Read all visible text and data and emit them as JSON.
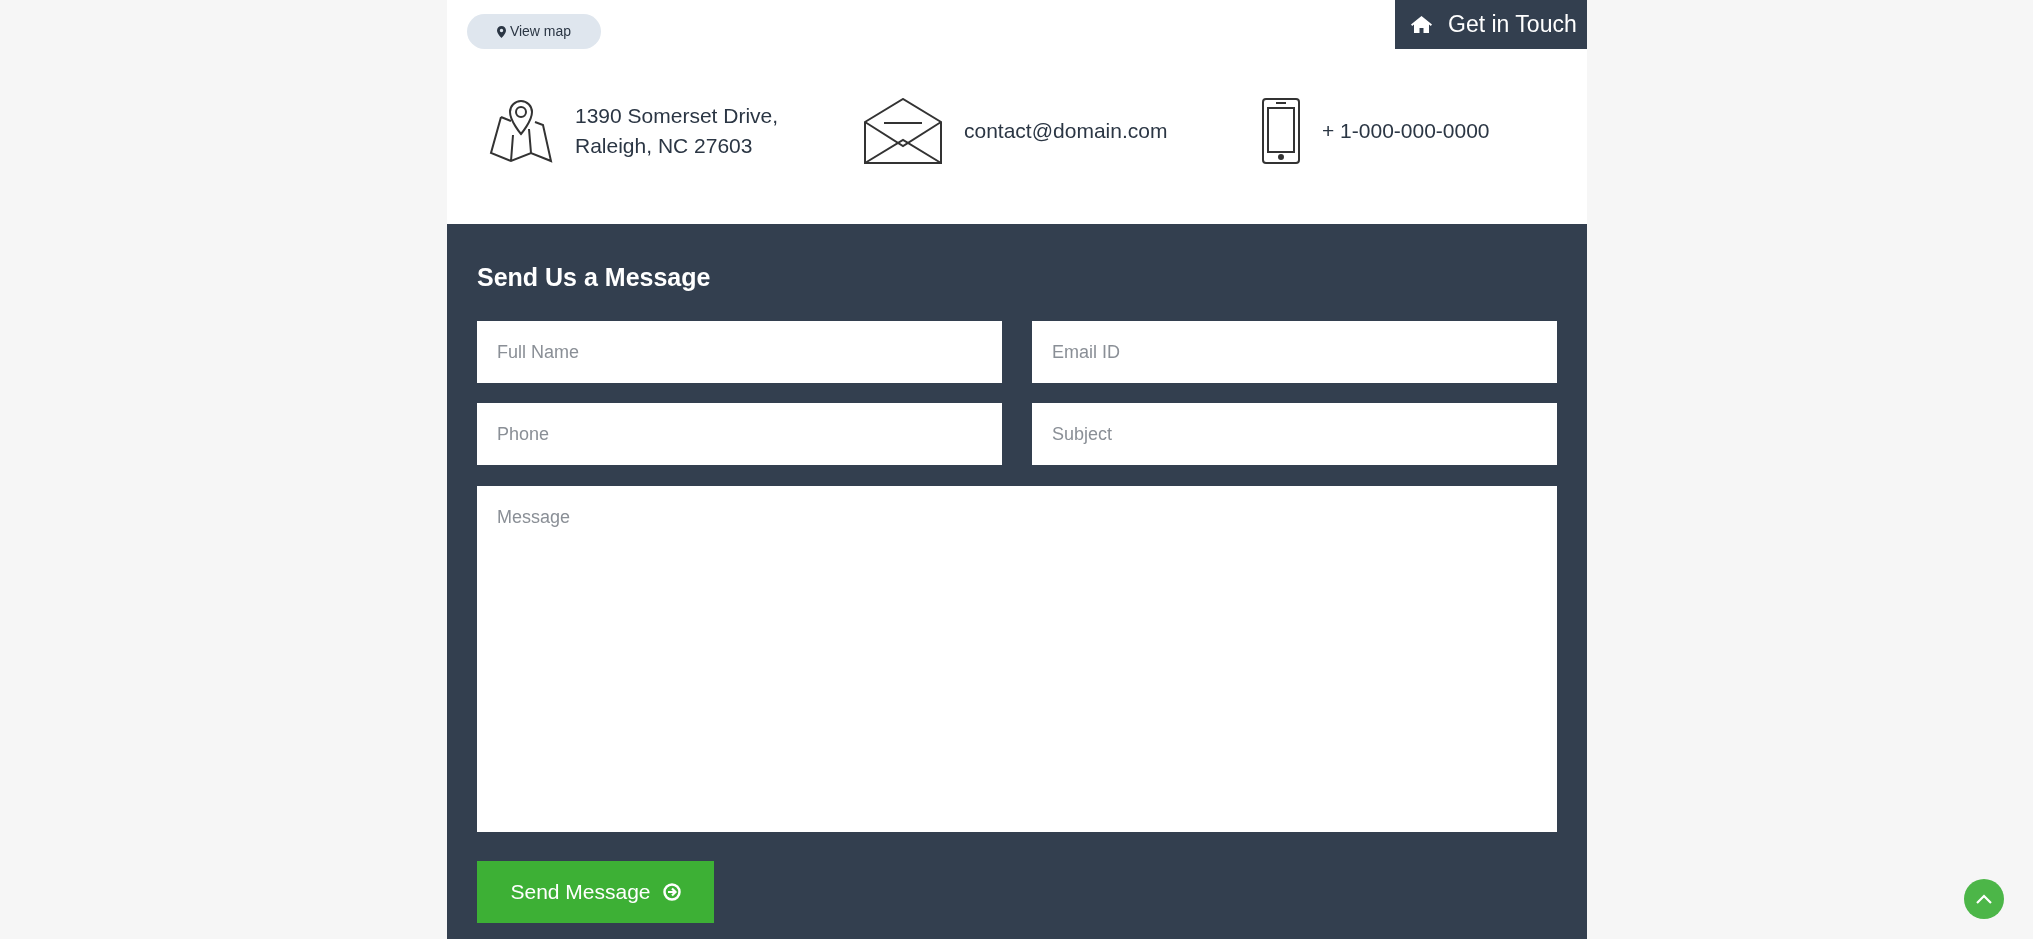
{
  "map_button": {
    "label": "View map"
  },
  "header_tab": {
    "label": "Get in Touch"
  },
  "contacts": [
    {
      "kind": "address",
      "lines": [
        "1390 Somerset Drive,",
        "Raleigh, NC 27603"
      ]
    },
    {
      "kind": "email",
      "lines": [
        "contact@domain.com"
      ]
    },
    {
      "kind": "phone",
      "lines": [
        "+ 1-000-000-0000"
      ]
    }
  ],
  "form": {
    "title": "Send Us a Message",
    "fields": [
      {
        "placeholder": "Full Name"
      },
      {
        "placeholder": "Email ID"
      },
      {
        "placeholder": "Phone"
      },
      {
        "placeholder": "Subject"
      }
    ],
    "message": {
      "placeholder": "Message"
    },
    "submit": {
      "label": "Send Message"
    }
  }
}
